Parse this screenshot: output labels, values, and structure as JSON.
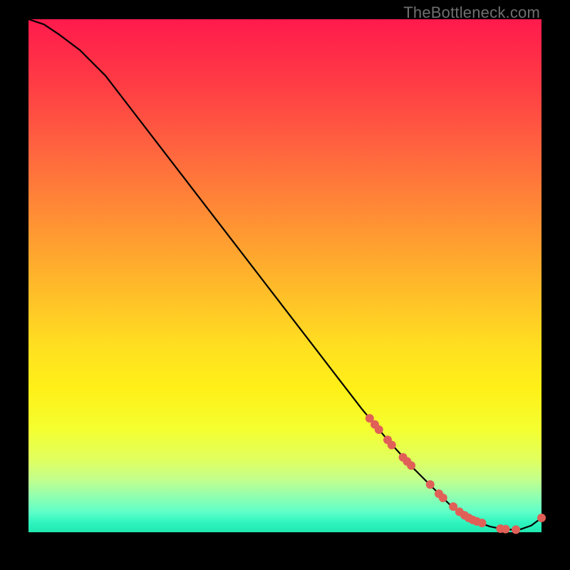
{
  "watermark": "TheBottleneck.com",
  "chart_data": {
    "type": "line",
    "title": "",
    "xlabel": "",
    "ylabel": "",
    "xlim": [
      0,
      100
    ],
    "ylim": [
      0,
      100
    ],
    "grid": false,
    "legend": false,
    "colors": {
      "curve": "#000000",
      "dots": "#e06058"
    },
    "series": [
      {
        "name": "bottleneck-curve",
        "x": [
          0,
          3,
          6,
          10,
          15,
          20,
          25,
          30,
          35,
          40,
          45,
          50,
          55,
          60,
          65,
          70,
          75,
          78,
          80,
          82,
          84,
          86,
          88,
          90,
          92,
          94,
          96,
          98,
          100
        ],
        "y": [
          100,
          99,
          97,
          94,
          89,
          82.5,
          76,
          69.5,
          63,
          56.5,
          50,
          43.5,
          37,
          30.5,
          24,
          18,
          12.5,
          9.5,
          7.5,
          5.5,
          4,
          2.8,
          1.8,
          1.1,
          0.7,
          0.5,
          0.6,
          1.3,
          2.8
        ]
      }
    ],
    "highlight_dots": {
      "name": "highlight-points",
      "x": [
        66.5,
        67.5,
        68.3,
        70.0,
        70.8,
        73.0,
        73.8,
        74.6,
        78.3,
        80.0,
        80.8,
        82.8,
        84.0,
        85.0,
        85.8,
        86.6,
        87.4,
        88.4,
        92.0,
        93.0,
        95.0,
        100.0
      ],
      "y": [
        22.2,
        21.0,
        20.0,
        18.0,
        17.0,
        14.6,
        13.8,
        13.0,
        9.3,
        7.5,
        6.7,
        5.0,
        4.0,
        3.3,
        2.8,
        2.4,
        2.1,
        1.8,
        0.7,
        0.6,
        0.5,
        2.8
      ]
    }
  }
}
